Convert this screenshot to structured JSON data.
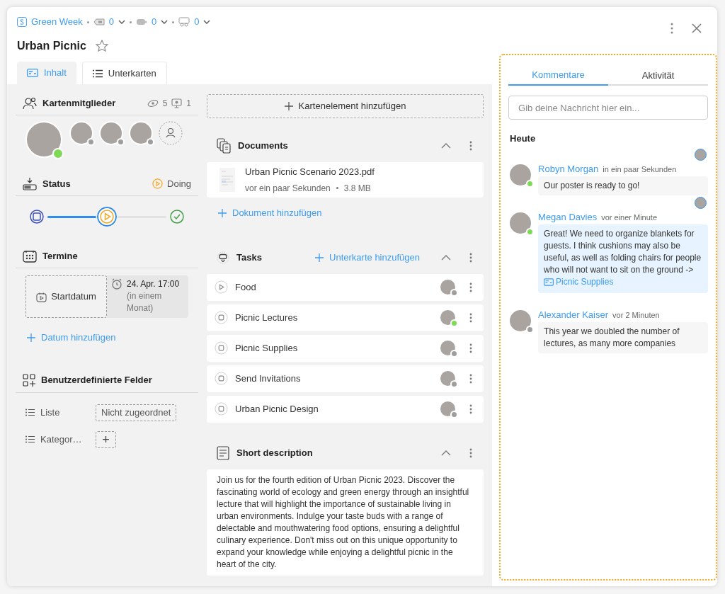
{
  "breadcrumb": {
    "board": "Green Week",
    "counters": [
      {
        "kind": "tag",
        "count": "0"
      },
      {
        "kind": "label",
        "count": "0"
      },
      {
        "kind": "link",
        "count": "0"
      }
    ]
  },
  "title": "Urban Picnic",
  "favorite": false,
  "tabs": [
    {
      "label": "Inhalt",
      "selected": true
    },
    {
      "label": "Unterkarten",
      "selected": false
    }
  ],
  "members": {
    "title": "Kartenmitglieder",
    "watchers": "5",
    "viewers": "1",
    "avatars": [
      {
        "online": true
      },
      {
        "online": false
      },
      {
        "online": false
      },
      {
        "online": false
      }
    ]
  },
  "status": {
    "title": "Status",
    "current": "Doing",
    "steps": [
      {
        "kind": "todo",
        "selected": false
      },
      {
        "kind": "doing",
        "selected": true
      },
      {
        "kind": "done",
        "selected": false
      }
    ]
  },
  "dates": {
    "title": "Termine",
    "start_label": "Startdatum",
    "date": "24. Apr. 17:00",
    "relative": "(in einem Monat)",
    "add": "Datum hinzufügen"
  },
  "custom_fields": {
    "title": "Benutzerdefinierte Felder",
    "fields": [
      {
        "label": "Liste",
        "kind": "value",
        "value": "Nicht zugeordnet"
      },
      {
        "label": "Kategor…",
        "kind": "add",
        "value": "+"
      }
    ]
  },
  "add_element": "Kartenelement hinzufügen",
  "documents": {
    "title": "Documents",
    "files": [
      {
        "name": "Urban Picnic Scenario 2023.pdf",
        "time": "vor ein paar Sekunden",
        "size": "3.8 MB"
      }
    ],
    "add": "Dokument hinzufügen"
  },
  "tasks": {
    "title": "Tasks",
    "add": "Unterkarte hinzufügen",
    "items": [
      {
        "name": "Food",
        "kind": "doing",
        "assignee_online": false
      },
      {
        "name": "Picnic Lectures",
        "kind": "todo",
        "assignee_online": true
      },
      {
        "name": "Picnic Supplies",
        "kind": "todo",
        "assignee_online": false
      },
      {
        "name": "Send Invitations",
        "kind": "todo",
        "assignee_online": false
      },
      {
        "name": "Urban Picnic Design",
        "kind": "todo",
        "assignee_online": false
      }
    ]
  },
  "description": {
    "title": "Short description",
    "text": "Join us for the fourth edition of Urban Picnic 2023. Discover the fascinating world of ecology and green energy through an insightful lecture that will highlight the importance of sustainable living in urban environments. Indulge your taste buds with a range of delectable and mouthwatering food options, ensuring a delightful culinary experience. Don't miss out on this unique opportunity to expand your knowledge while enjoying a delightful picnic in the heart of the city."
  },
  "comments_panel": {
    "tabs": [
      {
        "label": "Kommentare",
        "selected": true
      },
      {
        "label": "Aktivität",
        "selected": false
      }
    ],
    "input": {
      "placeholder": "Gib deine Nachricht hier ein..."
    },
    "day": "Heute",
    "comments": [
      {
        "author": "Robyn Morgan",
        "time": "in ein paar Sekunden",
        "text": "Our poster is ready to go!",
        "online": true,
        "highlighted": false,
        "read_receipt": true
      },
      {
        "author": "Megan Davies",
        "time": "vor einer Minute",
        "text": "Great! We need to organize blankets for guests. I think cushions may also be useful, as well as folding chairs for people who will not want to sit on the ground ->",
        "link": "Picnic Supplies",
        "online": true,
        "highlighted": true,
        "read_receipt": true
      },
      {
        "author": "Alexander Kaiser",
        "time": "vor 2 Minuten",
        "text": "This year we doubled the number of lectures, as many more companies",
        "online": false,
        "highlighted": false,
        "read_receipt": false
      }
    ]
  }
}
